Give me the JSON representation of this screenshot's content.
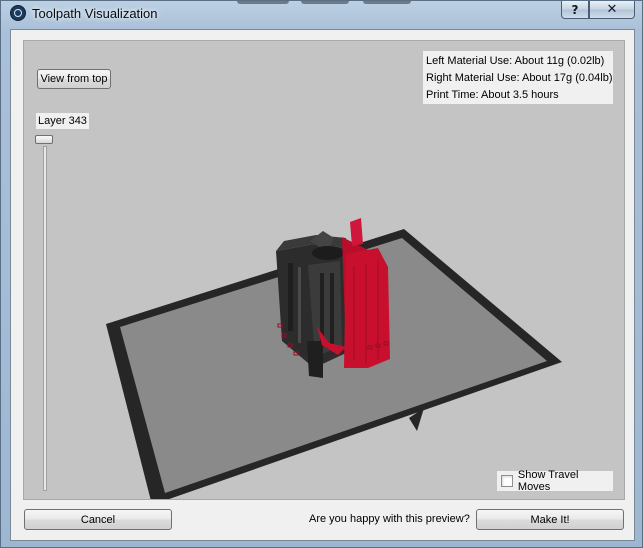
{
  "window": {
    "title": "Toolpath Visualization",
    "help_glyph": "?",
    "close_glyph": "✕"
  },
  "viewport": {
    "view_top_label": "View from top",
    "layer_label": "Layer 343",
    "layer_value": 343
  },
  "stats": {
    "left_material": "Left Material Use: About 11g (0.02lb)",
    "right_material": "Right Material Use: About 17g (0.04lb)",
    "print_time": "Print Time: About 3.5 hours"
  },
  "travel_moves": {
    "label": "Show Travel Moves",
    "checked": false
  },
  "footer": {
    "cancel_label": "Cancel",
    "prompt": "Are you happy with this preview?",
    "make_it_label": "Make It!"
  },
  "colors": {
    "left_extruder": "#2a2a2a",
    "right_extruder": "#c8102e",
    "build_plate": "#8a8a8a",
    "plate_border": "#262626",
    "background": "#c4c4c4"
  },
  "icons": {
    "app": "makerware-logo-icon",
    "help": "help-icon",
    "close": "close-icon"
  }
}
